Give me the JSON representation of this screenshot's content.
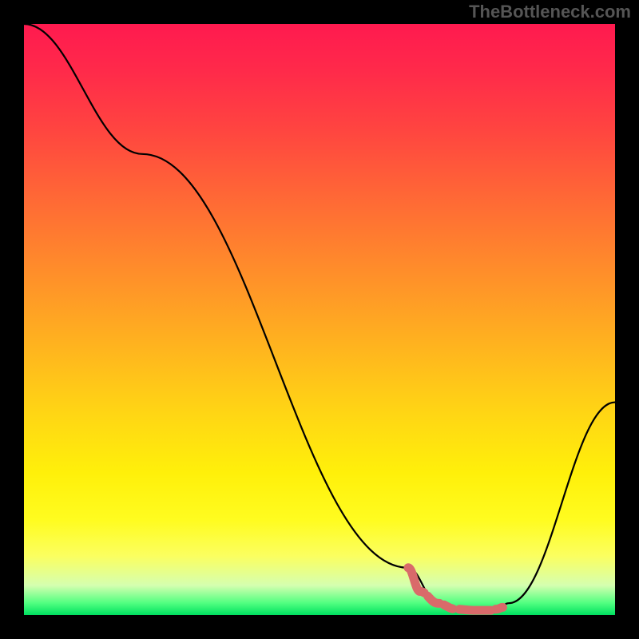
{
  "watermark": "TheBottleneck.com",
  "chart_data": {
    "type": "line",
    "title": "",
    "xlabel": "",
    "ylabel": "",
    "xlim": [
      0,
      100
    ],
    "ylim": [
      0,
      100
    ],
    "series": [
      {
        "name": "curve",
        "x": [
          0,
          20,
          65,
          70,
          72,
          75,
          78,
          80,
          82,
          100
        ],
        "values": [
          100,
          78,
          8,
          2,
          1,
          0.5,
          0.5,
          1,
          2,
          36
        ]
      }
    ],
    "highlight_segment": {
      "color": "#d96a6a",
      "x": [
        65,
        67,
        70,
        73,
        76,
        79,
        80,
        81
      ],
      "values": [
        8,
        4,
        2,
        1,
        0.8,
        0.8,
        1,
        1.3
      ]
    },
    "gradient_stops": [
      {
        "pos": 0,
        "color": "#ff1a4f"
      },
      {
        "pos": 18,
        "color": "#ff4540"
      },
      {
        "pos": 42,
        "color": "#ff8e2a"
      },
      {
        "pos": 66,
        "color": "#ffd614"
      },
      {
        "pos": 84,
        "color": "#fffc20"
      },
      {
        "pos": 95,
        "color": "#d5ffb0"
      },
      {
        "pos": 100,
        "color": "#00e060"
      }
    ]
  }
}
